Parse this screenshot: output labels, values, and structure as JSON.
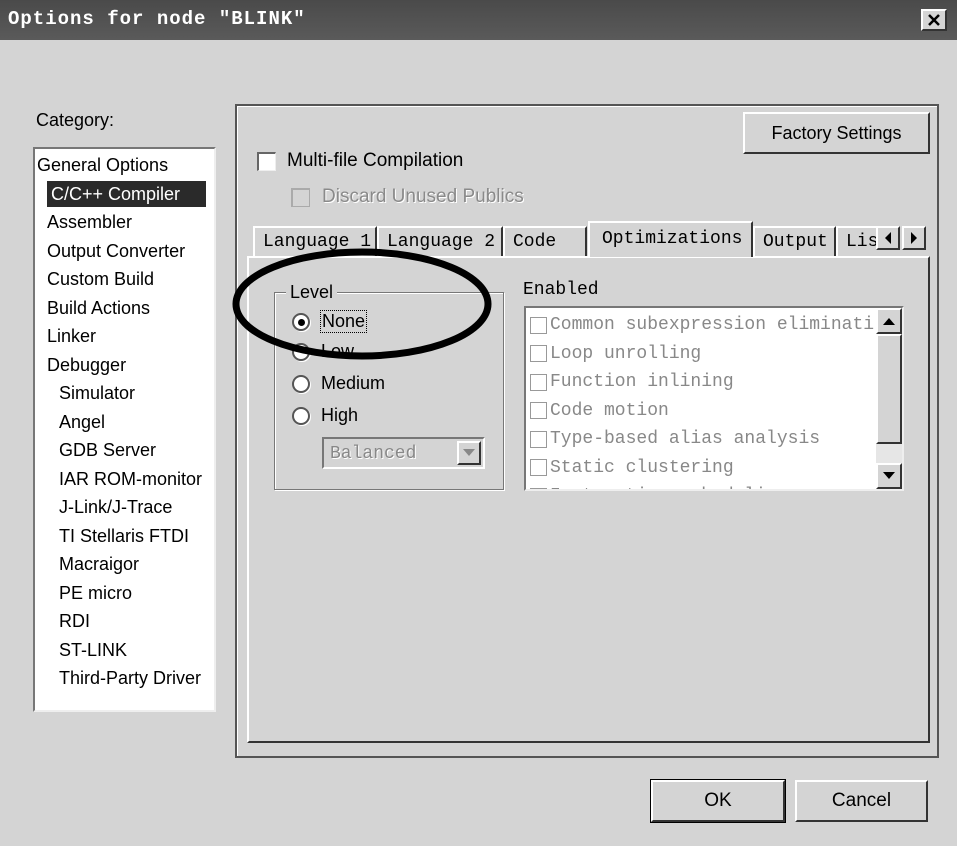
{
  "window": {
    "title": "Options for node \"BLINK\"",
    "close_glyph": "✕"
  },
  "category": {
    "label": "Category:",
    "items": [
      {
        "label": "General Options",
        "indent": 0
      },
      {
        "label": "C/C++ Compiler",
        "indent": 1,
        "selected": true
      },
      {
        "label": "Assembler",
        "indent": 1
      },
      {
        "label": "Output Converter",
        "indent": 1
      },
      {
        "label": "Custom Build",
        "indent": 1
      },
      {
        "label": "Build Actions",
        "indent": 1
      },
      {
        "label": "Linker",
        "indent": 1
      },
      {
        "label": "Debugger",
        "indent": 1
      },
      {
        "label": "Simulator",
        "indent": 2
      },
      {
        "label": "Angel",
        "indent": 2
      },
      {
        "label": "GDB Server",
        "indent": 2
      },
      {
        "label": "IAR ROM-monitor",
        "indent": 2
      },
      {
        "label": "J-Link/J-Trace",
        "indent": 2
      },
      {
        "label": "TI Stellaris FTDI",
        "indent": 2
      },
      {
        "label": "Macraigor",
        "indent": 2
      },
      {
        "label": "PE micro",
        "indent": 2
      },
      {
        "label": "RDI",
        "indent": 2
      },
      {
        "label": "ST-LINK",
        "indent": 2
      },
      {
        "label": "Third-Party Driver",
        "indent": 2
      }
    ]
  },
  "factory_settings_label": "Factory Settings",
  "multi_file": {
    "label": "Multi-file Compilation",
    "checked": false
  },
  "discard_unused": {
    "label": "Discard Unused Publics",
    "checked": false,
    "disabled": true
  },
  "tabs": [
    {
      "label": "Language 1"
    },
    {
      "label": "Language 2"
    },
    {
      "label": "Code"
    },
    {
      "label": "Optimizations",
      "active": true
    },
    {
      "label": "Output"
    },
    {
      "label": "Lis"
    }
  ],
  "level": {
    "title": "Level",
    "options": [
      {
        "label": "None",
        "selected": true
      },
      {
        "label": "Low"
      },
      {
        "label": "Medium"
      },
      {
        "label": "High"
      }
    ],
    "mode_value": "Balanced"
  },
  "enabled": {
    "title": "Enabled",
    "items": [
      "Common subexpression eliminati",
      "Loop unrolling",
      "Function inlining",
      "Code motion",
      "Type-based alias analysis",
      "Static clustering",
      "Instruction scheduling"
    ]
  },
  "buttons": {
    "ok": "OK",
    "cancel": "Cancel"
  },
  "colors": {
    "titlebar": "#4a4a4a",
    "dialog_bg": "#d4d4d4",
    "selection": "#2a2a2a"
  }
}
